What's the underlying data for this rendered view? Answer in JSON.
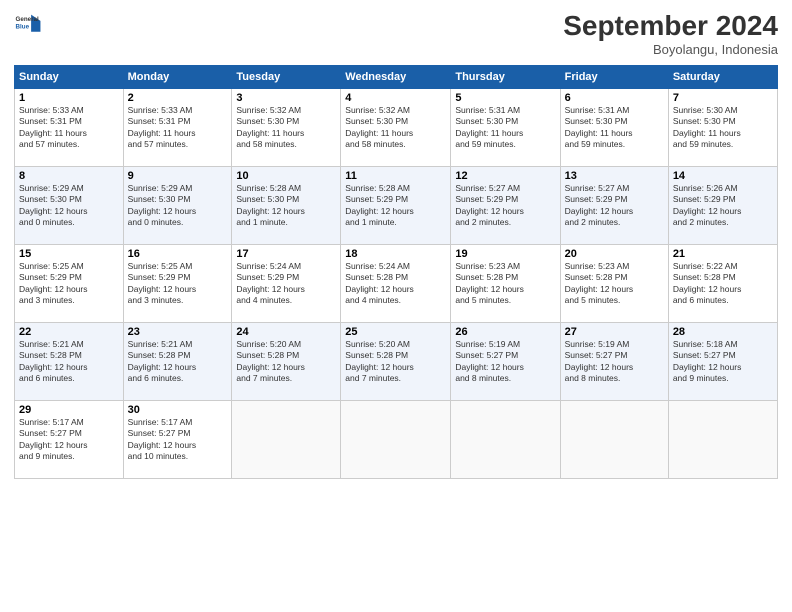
{
  "logo": {
    "line1": "General",
    "line2": "Blue"
  },
  "title": "September 2024",
  "location": "Boyolangu, Indonesia",
  "days_header": [
    "Sunday",
    "Monday",
    "Tuesday",
    "Wednesday",
    "Thursday",
    "Friday",
    "Saturday"
  ],
  "weeks": [
    [
      {
        "day": "1",
        "info": "Sunrise: 5:33 AM\nSunset: 5:31 PM\nDaylight: 11 hours\nand 57 minutes."
      },
      {
        "day": "2",
        "info": "Sunrise: 5:33 AM\nSunset: 5:31 PM\nDaylight: 11 hours\nand 57 minutes."
      },
      {
        "day": "3",
        "info": "Sunrise: 5:32 AM\nSunset: 5:30 PM\nDaylight: 11 hours\nand 58 minutes."
      },
      {
        "day": "4",
        "info": "Sunrise: 5:32 AM\nSunset: 5:30 PM\nDaylight: 11 hours\nand 58 minutes."
      },
      {
        "day": "5",
        "info": "Sunrise: 5:31 AM\nSunset: 5:30 PM\nDaylight: 11 hours\nand 59 minutes."
      },
      {
        "day": "6",
        "info": "Sunrise: 5:31 AM\nSunset: 5:30 PM\nDaylight: 11 hours\nand 59 minutes."
      },
      {
        "day": "7",
        "info": "Sunrise: 5:30 AM\nSunset: 5:30 PM\nDaylight: 11 hours\nand 59 minutes."
      }
    ],
    [
      {
        "day": "8",
        "info": "Sunrise: 5:29 AM\nSunset: 5:30 PM\nDaylight: 12 hours\nand 0 minutes."
      },
      {
        "day": "9",
        "info": "Sunrise: 5:29 AM\nSunset: 5:30 PM\nDaylight: 12 hours\nand 0 minutes."
      },
      {
        "day": "10",
        "info": "Sunrise: 5:28 AM\nSunset: 5:30 PM\nDaylight: 12 hours\nand 1 minute."
      },
      {
        "day": "11",
        "info": "Sunrise: 5:28 AM\nSunset: 5:29 PM\nDaylight: 12 hours\nand 1 minute."
      },
      {
        "day": "12",
        "info": "Sunrise: 5:27 AM\nSunset: 5:29 PM\nDaylight: 12 hours\nand 2 minutes."
      },
      {
        "day": "13",
        "info": "Sunrise: 5:27 AM\nSunset: 5:29 PM\nDaylight: 12 hours\nand 2 minutes."
      },
      {
        "day": "14",
        "info": "Sunrise: 5:26 AM\nSunset: 5:29 PM\nDaylight: 12 hours\nand 2 minutes."
      }
    ],
    [
      {
        "day": "15",
        "info": "Sunrise: 5:25 AM\nSunset: 5:29 PM\nDaylight: 12 hours\nand 3 minutes."
      },
      {
        "day": "16",
        "info": "Sunrise: 5:25 AM\nSunset: 5:29 PM\nDaylight: 12 hours\nand 3 minutes."
      },
      {
        "day": "17",
        "info": "Sunrise: 5:24 AM\nSunset: 5:29 PM\nDaylight: 12 hours\nand 4 minutes."
      },
      {
        "day": "18",
        "info": "Sunrise: 5:24 AM\nSunset: 5:28 PM\nDaylight: 12 hours\nand 4 minutes."
      },
      {
        "day": "19",
        "info": "Sunrise: 5:23 AM\nSunset: 5:28 PM\nDaylight: 12 hours\nand 5 minutes."
      },
      {
        "day": "20",
        "info": "Sunrise: 5:23 AM\nSunset: 5:28 PM\nDaylight: 12 hours\nand 5 minutes."
      },
      {
        "day": "21",
        "info": "Sunrise: 5:22 AM\nSunset: 5:28 PM\nDaylight: 12 hours\nand 6 minutes."
      }
    ],
    [
      {
        "day": "22",
        "info": "Sunrise: 5:21 AM\nSunset: 5:28 PM\nDaylight: 12 hours\nand 6 minutes."
      },
      {
        "day": "23",
        "info": "Sunrise: 5:21 AM\nSunset: 5:28 PM\nDaylight: 12 hours\nand 6 minutes."
      },
      {
        "day": "24",
        "info": "Sunrise: 5:20 AM\nSunset: 5:28 PM\nDaylight: 12 hours\nand 7 minutes."
      },
      {
        "day": "25",
        "info": "Sunrise: 5:20 AM\nSunset: 5:28 PM\nDaylight: 12 hours\nand 7 minutes."
      },
      {
        "day": "26",
        "info": "Sunrise: 5:19 AM\nSunset: 5:27 PM\nDaylight: 12 hours\nand 8 minutes."
      },
      {
        "day": "27",
        "info": "Sunrise: 5:19 AM\nSunset: 5:27 PM\nDaylight: 12 hours\nand 8 minutes."
      },
      {
        "day": "28",
        "info": "Sunrise: 5:18 AM\nSunset: 5:27 PM\nDaylight: 12 hours\nand 9 minutes."
      }
    ],
    [
      {
        "day": "29",
        "info": "Sunrise: 5:17 AM\nSunset: 5:27 PM\nDaylight: 12 hours\nand 9 minutes."
      },
      {
        "day": "30",
        "info": "Sunrise: 5:17 AM\nSunset: 5:27 PM\nDaylight: 12 hours\nand 10 minutes."
      },
      {
        "day": "",
        "info": ""
      },
      {
        "day": "",
        "info": ""
      },
      {
        "day": "",
        "info": ""
      },
      {
        "day": "",
        "info": ""
      },
      {
        "day": "",
        "info": ""
      }
    ]
  ]
}
